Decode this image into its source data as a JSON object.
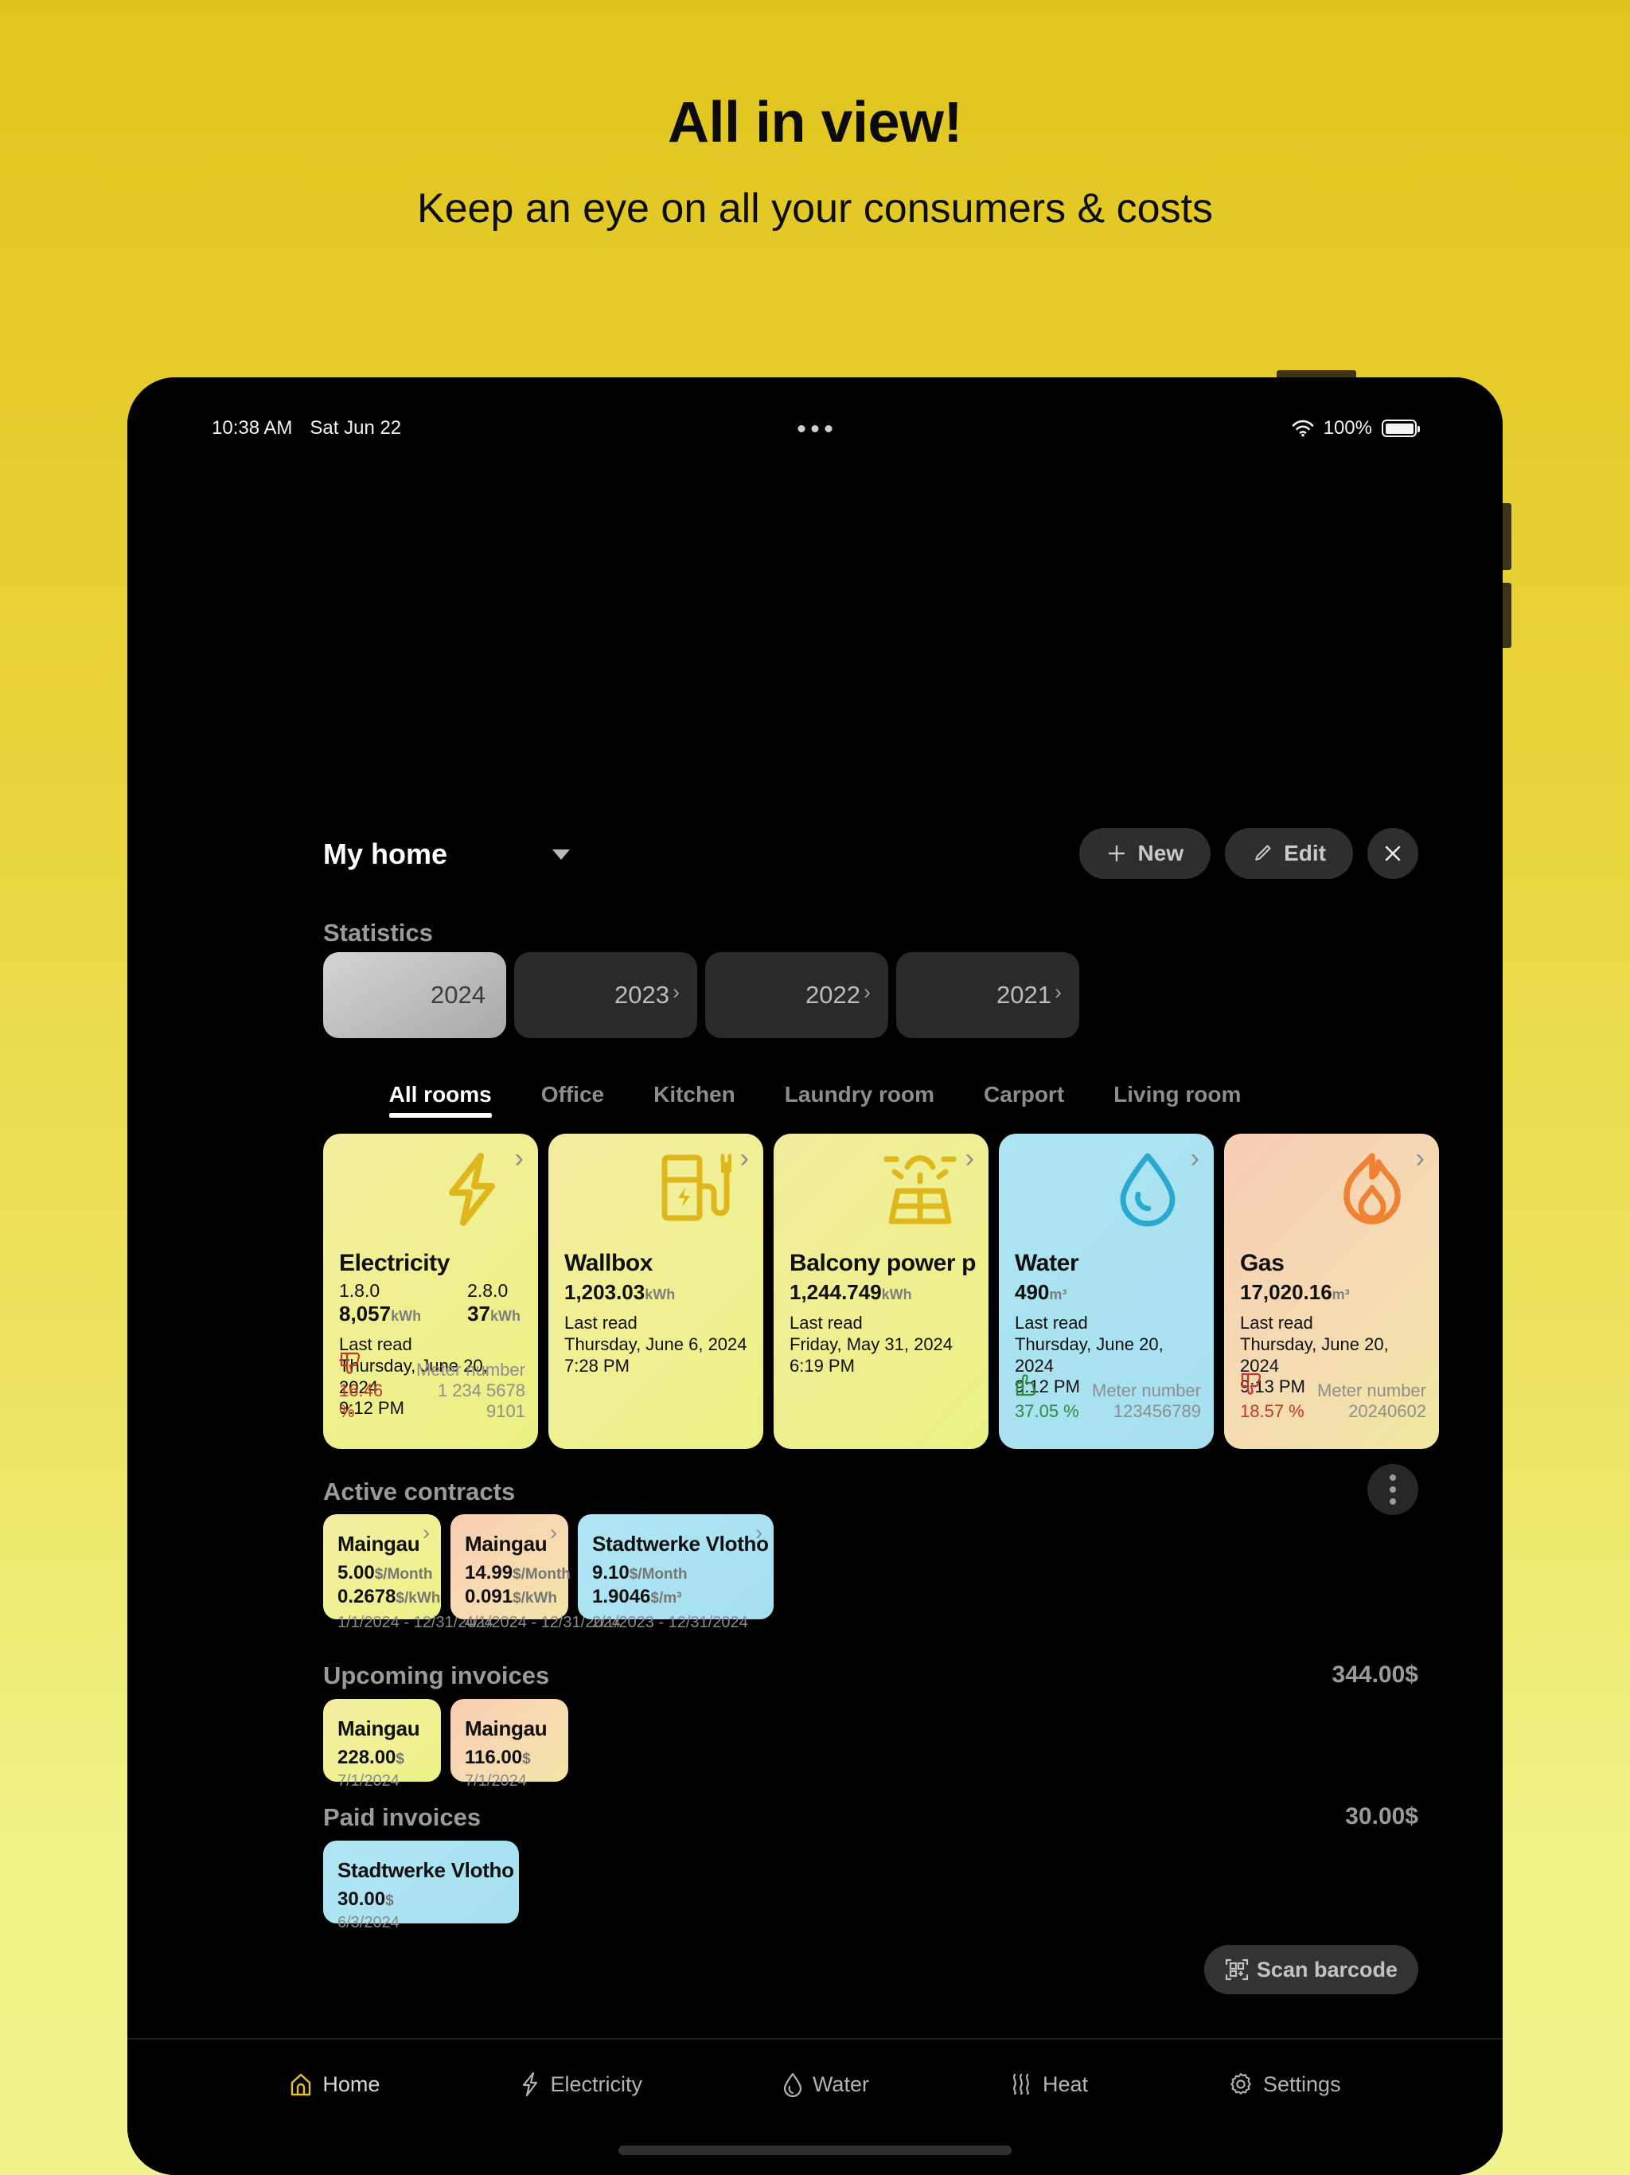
{
  "promo": {
    "title": "All in view!",
    "subtitle": "Keep an eye on all your consumers & costs"
  },
  "statusbar": {
    "time": "10:38 AM",
    "date": "Sat Jun 22",
    "battery_percent": "100%",
    "wifi_icon": "wifi-icon",
    "more_icon": "more-horizontal-icon"
  },
  "topbar": {
    "home_name": "My home",
    "dropdown_icon": "chevron-down-icon",
    "new_label": "New",
    "new_icon": "plus-icon",
    "edit_label": "Edit",
    "edit_icon": "pencil-icon",
    "close_icon": "close-icon"
  },
  "statistics": {
    "title": "Statistics",
    "years": [
      {
        "label": "2024",
        "selected": true
      },
      {
        "label": "2023",
        "selected": false
      },
      {
        "label": "2022",
        "selected": false
      },
      {
        "label": "2021",
        "selected": false
      }
    ]
  },
  "room_tabs": [
    {
      "label": "All rooms",
      "active": true
    },
    {
      "label": "Office",
      "active": false
    },
    {
      "label": "Kitchen",
      "active": false
    },
    {
      "label": "Laundry room",
      "active": false
    },
    {
      "label": "Carport",
      "active": false
    },
    {
      "label": "Living room",
      "active": false
    }
  ],
  "consumers": [
    {
      "name": "Electricity",
      "icon": "lightning-bolt-icon",
      "readings": [
        {
          "label": "1.8.0",
          "value": "8,057",
          "unit": "kWh"
        },
        {
          "label": "2.8.0",
          "value": "37",
          "unit": "kWh"
        }
      ],
      "last_read_label": "Last read",
      "last_read_date": "Thursday, June 20, 2024",
      "last_read_time": "9:12 PM",
      "trend_direction": "down",
      "trend_icon": "thumbs-down-icon",
      "trend_value": "16.46 %",
      "trend_color": "#c0392b",
      "meter_label": "Meter number",
      "meter_value": "1 234 5678 9101"
    },
    {
      "name": "Wallbox",
      "icon": "ev-charger-icon",
      "readings": [
        {
          "label": "",
          "value": "1,203.03",
          "unit": "kWh"
        }
      ],
      "last_read_label": "Last read",
      "last_read_date": "Thursday, June 6, 2024",
      "last_read_time": "7:28 PM",
      "trend_direction": "",
      "trend_icon": "",
      "trend_value": "",
      "trend_color": "",
      "meter_label": "",
      "meter_value": ""
    },
    {
      "name": "Balcony power p…",
      "icon": "solar-panel-icon",
      "readings": [
        {
          "label": "",
          "value": "1,244.749",
          "unit": "kWh"
        }
      ],
      "last_read_label": "Last read",
      "last_read_date": "Friday, May 31, 2024 6:19 PM",
      "last_read_time": "",
      "trend_direction": "",
      "trend_icon": "",
      "trend_value": "",
      "trend_color": "",
      "meter_label": "",
      "meter_value": ""
    },
    {
      "name": "Water",
      "icon": "water-drop-icon",
      "readings": [
        {
          "label": "",
          "value": "490",
          "unit": "m³"
        }
      ],
      "last_read_label": "Last read",
      "last_read_date": "Thursday, June 20, 2024",
      "last_read_time": "9:12 PM",
      "trend_direction": "up",
      "trend_icon": "thumbs-up-icon",
      "trend_value": "37.05 %",
      "trend_color": "#2e8b43",
      "meter_label": "Meter number",
      "meter_value": "123456789"
    },
    {
      "name": "Gas",
      "icon": "flame-icon",
      "readings": [
        {
          "label": "",
          "value": "17,020.16",
          "unit": "m³"
        }
      ],
      "last_read_label": "Last read",
      "last_read_date": "Thursday, June 20, 2024",
      "last_read_time": "9:13 PM",
      "trend_direction": "down",
      "trend_icon": "thumbs-down-icon",
      "trend_value": "18.57 %",
      "trend_color": "#c0392b",
      "meter_label": "Meter number",
      "meter_value": "20240602"
    }
  ],
  "active_contracts": {
    "title": "Active contracts",
    "menu_icon": "more-vertical-icon",
    "items": [
      {
        "name": "Maingau",
        "price_base": "5.00",
        "price_base_unit": "$/Month",
        "price_rate": "0.2678",
        "price_rate_unit": "$/kWh",
        "period": "1/1/2024 - 12/31/2024"
      },
      {
        "name": "Maingau",
        "price_base": "14.99",
        "price_base_unit": "$/Month",
        "price_rate": "0.091",
        "price_rate_unit": "$/kWh",
        "period": "4/1/2024 - 12/31/2024"
      },
      {
        "name": "Stadtwerke Vlotho",
        "price_base": "9.10",
        "price_base_unit": "$/Month",
        "price_rate": "1.9046",
        "price_rate_unit": "$/m³",
        "period": "2/1/2023 - 12/31/2024"
      }
    ]
  },
  "upcoming_invoices": {
    "title": "Upcoming invoices",
    "total": "344.00$",
    "items": [
      {
        "name": "Maingau",
        "amount": "228.00",
        "currency": "$",
        "date": "7/1/2024"
      },
      {
        "name": "Maingau",
        "amount": "116.00",
        "currency": "$",
        "date": "7/1/2024"
      }
    ]
  },
  "paid_invoices": {
    "title": "Paid invoices",
    "total": "30.00$",
    "items": [
      {
        "name": "Stadtwerke Vlotho",
        "amount": "30.00",
        "currency": "$",
        "date": "6/3/2024"
      }
    ]
  },
  "scan": {
    "label": "Scan barcode",
    "icon": "qr-scan-icon"
  },
  "navbar": [
    {
      "label": "Home",
      "icon": "home-icon",
      "active": true
    },
    {
      "label": "Electricity",
      "icon": "lightning-bolt-icon",
      "active": false
    },
    {
      "label": "Water",
      "icon": "water-drop-icon",
      "active": false
    },
    {
      "label": "Heat",
      "icon": "heat-waves-icon",
      "active": false
    },
    {
      "label": "Settings",
      "icon": "gear-icon",
      "active": false
    }
  ],
  "colors": {
    "accent_yellow": "#e3c51f",
    "card_yellow": "#eef08e",
    "card_blue": "#a9e2f0",
    "card_peach": "#f6d6ad",
    "icon_gold": "#e0b91b",
    "icon_blue": "#2aa8cf",
    "icon_orange": "#ef8233",
    "nav_active": "#e8c31c"
  }
}
